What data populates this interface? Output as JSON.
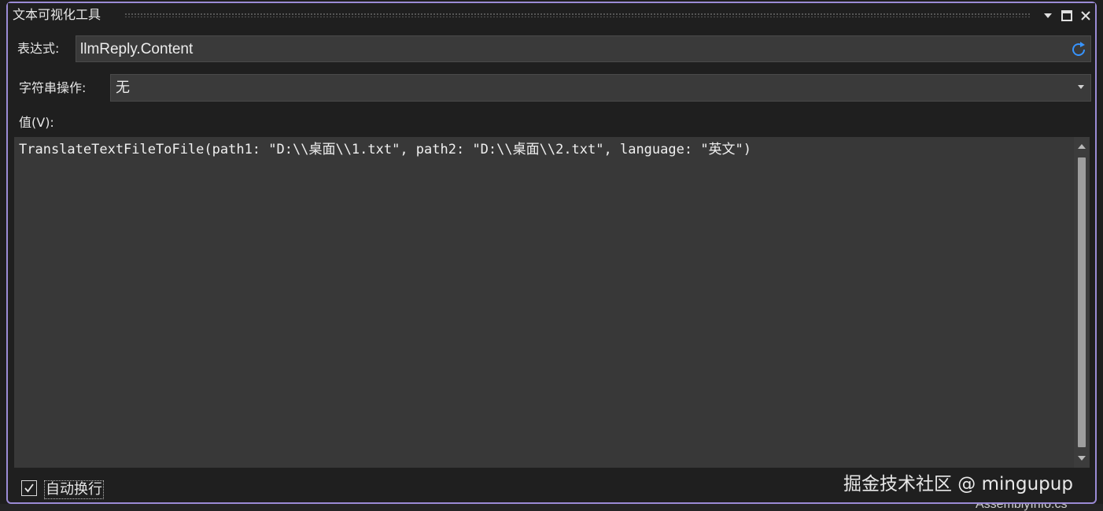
{
  "window": {
    "title": "文本可视化工具"
  },
  "titlebar_buttons": {
    "dropdown_icon": "chevron-down-icon",
    "maximize_icon": "maximize-icon",
    "close_icon": "close-icon"
  },
  "expression": {
    "label": "表达式:",
    "value": "llmReply.Content",
    "refresh_icon": "refresh-icon"
  },
  "string_operation": {
    "label": "字符串操作:",
    "selected": "无"
  },
  "value_section": {
    "label": "值(V):",
    "content": "TranslateTextFileToFile(path1: \"D:\\\\桌面\\\\1.txt\", path2: \"D:\\\\桌面\\\\2.txt\", language: \"英文\")"
  },
  "word_wrap": {
    "label": "自动换行",
    "checked": true
  },
  "watermark": "掘金技术社区 @ mingupup",
  "background_text": "AssemblyInfo.cs",
  "colors": {
    "accent_border": "#9b8bd6",
    "refresh": "#3794ff"
  }
}
